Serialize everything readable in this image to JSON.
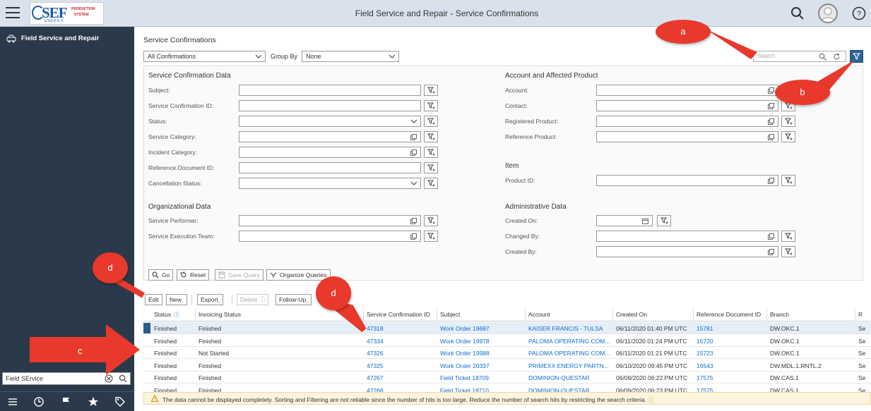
{
  "header": {
    "title": "Field Service and Repair - Service Confirmations",
    "logo": {
      "mark": "SEF",
      "line1": "PRODUCTION",
      "line2": "SYSTEM",
      "line3": "ENERGY"
    }
  },
  "sidebar": {
    "item_label": "Field Service and Repair",
    "search_value": "Field SErvice"
  },
  "main": {
    "page_title": "Service Confirmations",
    "view_select": "All Confirmations",
    "group_by_label": "Group By",
    "group_by_value": "None",
    "search_placeholder": "Search"
  },
  "filters": {
    "sections": {
      "service_data": "Service Confirmation Data",
      "account": "Account and Affected Product",
      "item": "Item",
      "org": "Organizational Data",
      "admin": "Administrative Data"
    },
    "left": [
      "Subject:",
      "Service Confirmation ID:",
      "Status:",
      "Service Category:",
      "Incident Category:",
      "Reference Document ID:",
      "Cancellation Status:"
    ],
    "org": [
      "Service Performer:",
      "Service Execution Team:"
    ],
    "right": [
      "Account:",
      "Contact:",
      "Registered Product:",
      "Reference Product:"
    ],
    "item": [
      "Product ID:"
    ],
    "admin": [
      "Created On:",
      "Changed By:",
      "Created By:"
    ]
  },
  "query_buttons": {
    "go": "Go",
    "reset": "Reset",
    "save": "Save Query",
    "organize": "Organize Queries"
  },
  "toolbar": {
    "edit": "Edit",
    "new": "New",
    "export": "Export",
    "delete": "Delete",
    "follow_up": "Follow-Up"
  },
  "table": {
    "columns": [
      "Status",
      "Invoicing Status",
      "Service Confirmation ID",
      "Subject",
      "Account",
      "Created On",
      "Reference Document ID",
      "Branch",
      "R"
    ],
    "rows": [
      {
        "status": "Finished",
        "invoicing": "Finished",
        "id": "47318",
        "subject": "Work Order 19687",
        "account": "KAISER FRANCIS - TULSA",
        "created": "06/11/2020 01:40 PM UTC",
        "ref": "15781",
        "branch": "DW.OKC.1",
        "extra": "Se"
      },
      {
        "status": "Finished",
        "invoicing": "Finished",
        "id": "47334",
        "subject": "Work Order 19978",
        "account": "PALOMA OPERATING COM...",
        "created": "06/11/2020 01:24 PM UTC",
        "ref": "15720",
        "branch": "DW.OKC.1",
        "extra": "Se"
      },
      {
        "status": "Finished",
        "invoicing": "Not Started",
        "id": "47326",
        "subject": "Work Order 19988",
        "account": "PALOMA OPERATING COM...",
        "created": "06/11/2020 01:21 PM UTC",
        "ref": "15723",
        "branch": "DW.OKC.1",
        "extra": "Se"
      },
      {
        "status": "Finished",
        "invoicing": "Finished",
        "id": "47325",
        "subject": "Work Order 20337",
        "account": "PRIMEXX ENERGY PARTN...",
        "created": "06/10/2020 09:45 PM UTC",
        "ref": "16543",
        "branch": "DW.MDL.1.RNTL.2",
        "extra": "Se"
      },
      {
        "status": "Finished",
        "invoicing": "Finished",
        "id": "47267",
        "subject": "Field Ticket 18709",
        "account": "DOMINION-QUESTAR",
        "created": "06/09/2020 06:22 PM UTC",
        "ref": "17575",
        "branch": "DW.CAS.1",
        "extra": "Se"
      },
      {
        "status": "Finished",
        "invoicing": "Finished",
        "id": "47268",
        "subject": "Field Ticket 18710",
        "account": "DOMINION-QUESTAR",
        "created": "06/09/2020 06:23 PM UTC",
        "ref": "17575",
        "branch": "DW.CAS.1",
        "extra": "Se"
      }
    ]
  },
  "message": "The data cannot be displayed completely. Sorting and Filtering are not reliable since the number of hits is too large. Reduce the number of search hits by restricting the search criteria.",
  "callouts": {
    "a": "a",
    "b": "b",
    "c": "c",
    "d1": "d",
    "d2": "d"
  },
  "colors": {
    "callout": "#e8392c",
    "sidebar": "#2b3a4a",
    "header": "#d9e2ec",
    "link": "#0a6ed1"
  }
}
